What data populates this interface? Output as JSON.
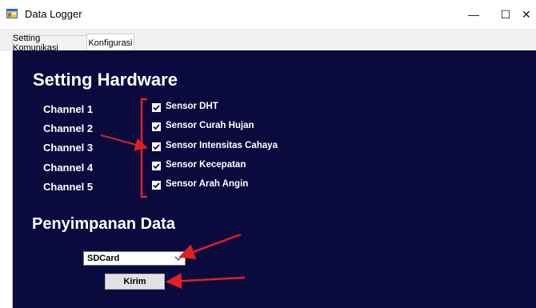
{
  "window": {
    "title": "Data Logger",
    "minimize_glyph": "—",
    "maximize_glyph": "☐",
    "close_glyph": "✕"
  },
  "tabs": [
    {
      "label": "Setting Komunikasi",
      "active": false
    },
    {
      "label": "Konfigurasi",
      "active": true
    }
  ],
  "hardware": {
    "heading": "Setting Hardware",
    "channels": [
      {
        "channel": "Channel 1",
        "sensor": "Sensor DHT",
        "checked": true
      },
      {
        "channel": "Channel 2",
        "sensor": "Sensor Curah Hujan",
        "checked": true
      },
      {
        "channel": "Channel 3",
        "sensor": "Sensor Intensitas Cahaya",
        "checked": true
      },
      {
        "channel": "Channel 4",
        "sensor": "Sensor Kecepatan",
        "checked": true
      },
      {
        "channel": "Channel 5",
        "sensor": "Sensor Arah Angin",
        "checked": true
      }
    ]
  },
  "storage": {
    "heading": "Penyimpanan Data",
    "select_value": "SDCard",
    "submit_label": "Kirim"
  },
  "colors": {
    "panel_bg": "#0a0a3f",
    "annotation": "#e02020"
  },
  "icons": {
    "app": "app-window-icon",
    "dropdown": "chevron-down-icon",
    "check": "checkmark-icon"
  }
}
